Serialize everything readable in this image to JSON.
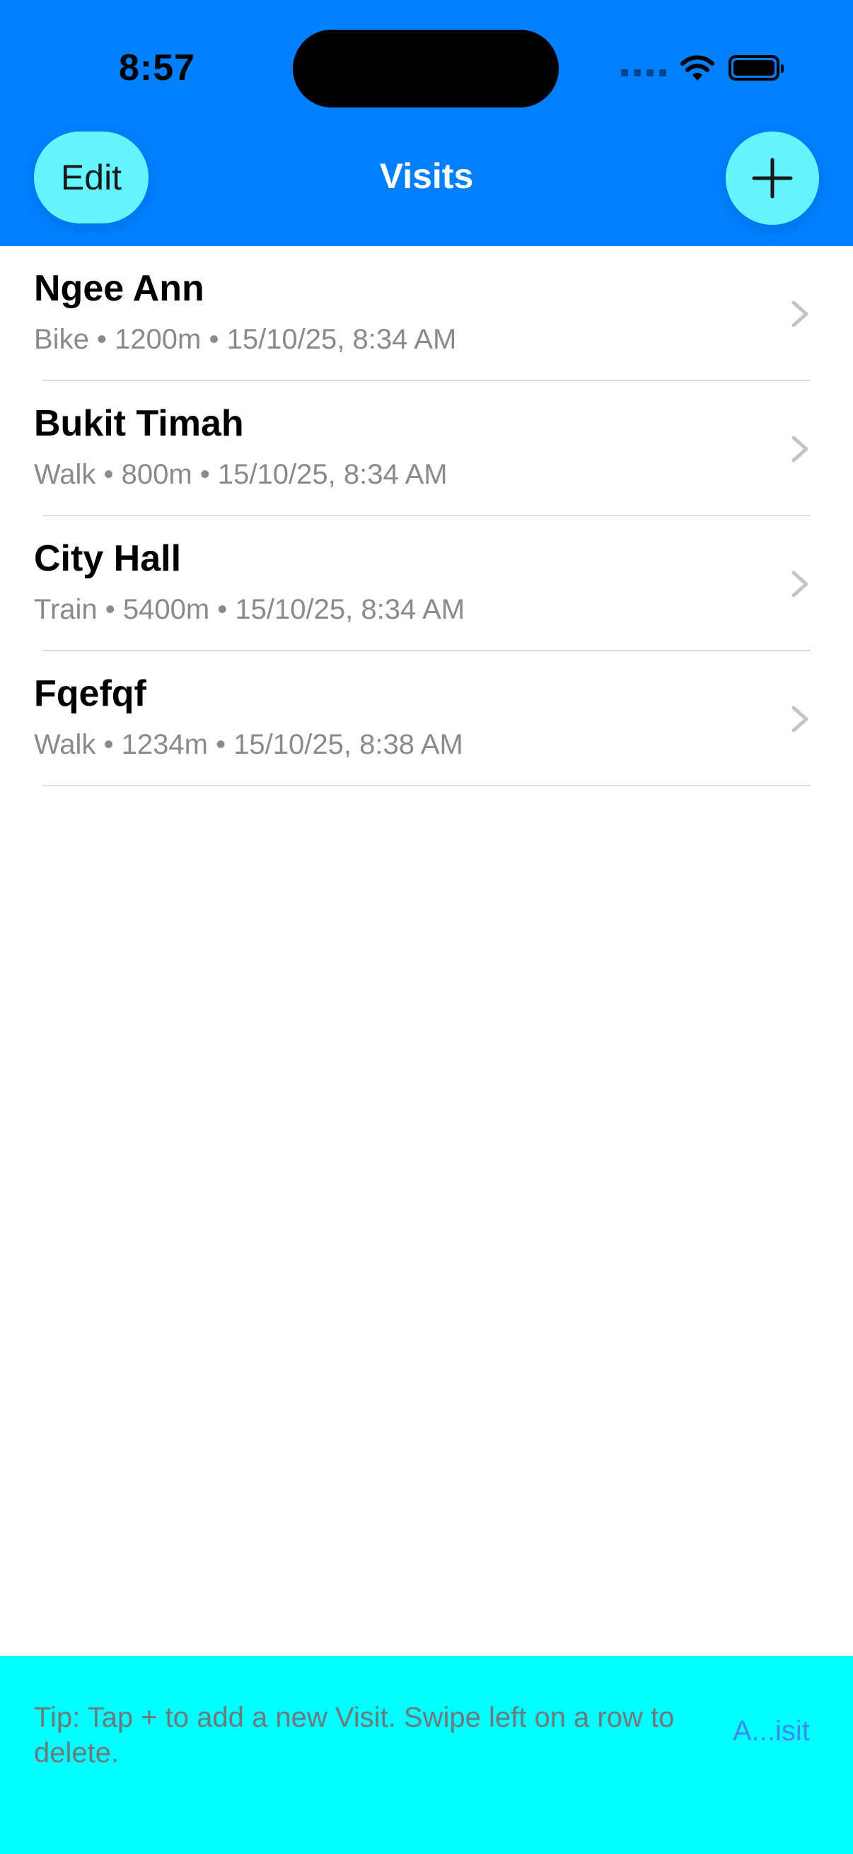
{
  "status_bar": {
    "time": "8:57"
  },
  "header": {
    "title": "Visits",
    "edit_label": "Edit",
    "add_icon": "plus-icon",
    "background_color": "#0080FF",
    "button_color": "#66F5FF"
  },
  "visits": [
    {
      "name": "Ngee Ann",
      "details": "Bike • 1200m • 15/10/25, 8:34 AM"
    },
    {
      "name": "Bukit Timah",
      "details": "Walk • 800m • 15/10/25, 8:34 AM"
    },
    {
      "name": "City Hall",
      "details": "Train • 5400m • 15/10/25, 8:34 AM"
    },
    {
      "name": "Fqefqf",
      "details": "Walk • 1234m • 15/10/25, 8:38 AM"
    }
  ],
  "footer": {
    "tip": "Tip: Tap + to add a new Visit. Swipe left on a row to delete.",
    "link_label": "A...isit",
    "background_color": "#00FFFF"
  }
}
